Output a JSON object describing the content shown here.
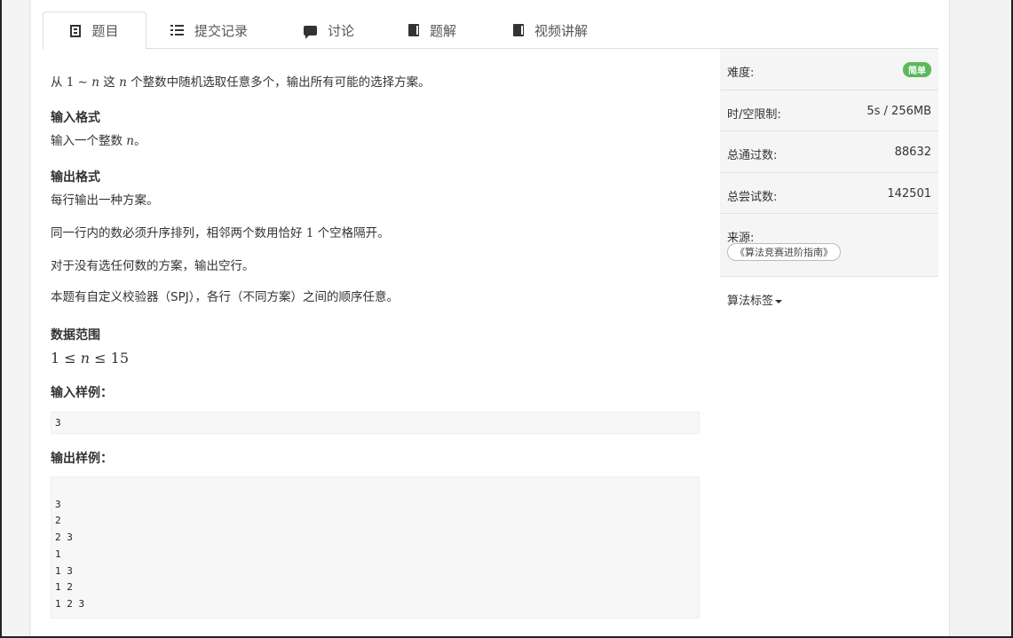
{
  "tabs": [
    {
      "label": "题目",
      "icon": "document-icon"
    },
    {
      "label": "提交记录",
      "icon": "list-icon"
    },
    {
      "label": "讨论",
      "icon": "comment-icon"
    },
    {
      "label": "题解",
      "icon": "book-icon"
    },
    {
      "label": "视频讲解",
      "icon": "book-icon"
    }
  ],
  "problem": {
    "desc_pre": "从 ",
    "desc_one": "1",
    "desc_tilde": " ∼ ",
    "desc_n": "n",
    "desc_mid": " 这 ",
    "desc_n2": "n",
    "desc_post": " 个整数中随机选取任意多个，输出所有可能的选择方案。",
    "input_title": "输入格式",
    "input_pre": "输入一个整数 ",
    "input_n": "n",
    "input_post": "。",
    "output_title": "输出格式",
    "output_line1": "每行输出一种方案。",
    "output_line2_pre": "同一行内的数必须升序排列，相邻两个数用恰好 ",
    "output_line2_num": "1",
    "output_line2_post": " 个空格隔开。",
    "output_line3": "对于没有选任何数的方案，输出空行。",
    "output_line4": "本题有自定义校验器（SPJ），各行（不同方案）之间的顺序任意。",
    "range_title": "数据范围",
    "range_left": "1 ≤ ",
    "range_n": "n",
    "range_right": " ≤ 15",
    "sample_in_title": "输入样例：",
    "sample_in": "3",
    "sample_out_title": "输出样例：",
    "sample_out": "\n3\n2\n2 3\n1\n1 3\n1 2\n1 2 3"
  },
  "sidebar": {
    "difficulty_label": "难度:",
    "difficulty_value": "简单",
    "difficulty_color": "#5cb85c",
    "limit_label": "时/空限制:",
    "limit_value": "5s / 256MB",
    "passed_label": "总通过数:",
    "passed_value": "88632",
    "tried_label": "总尝试数:",
    "tried_value": "142501",
    "source_label": "来源:",
    "source_value": "《算法竞赛进阶指南》",
    "tags_label": "算法标签"
  }
}
